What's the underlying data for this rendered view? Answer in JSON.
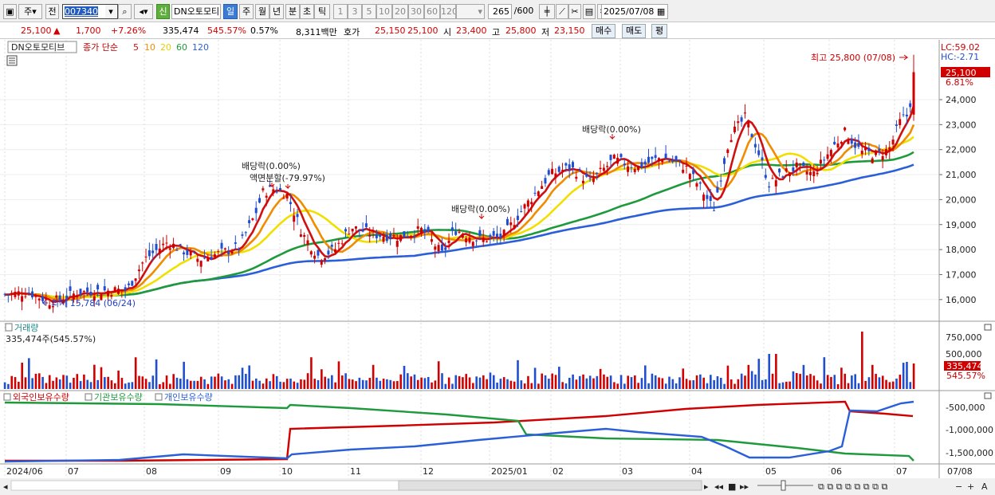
{
  "toolbar": {
    "period": "주",
    "prev": "전",
    "code": "007340",
    "news_badge": "신",
    "name": "DN오토모티",
    "tab_day": "일",
    "tab_week": "주",
    "tab_month": "월",
    "tab_year": "년",
    "tab_min": "분",
    "tab_sec": "초",
    "tab_tick": "틱",
    "nums": [
      "1",
      "3",
      "5",
      "10",
      "20",
      "30",
      "60",
      "120"
    ],
    "count": "265",
    "count_total": "/600",
    "date": "2025/07/08"
  },
  "info": {
    "price": "25,100",
    "arrow": "▲",
    "change": "1,700",
    "pct": "+7.26%",
    "volume": "335,474",
    "vol_pct": "545.57%",
    "turnover": "0.57%",
    "amount": "8,311백만",
    "quote_label": "호가",
    "ask": "25,150",
    "bid": "25,100",
    "open_label": "시",
    "open": "23,400",
    "high_label": "고",
    "high": "25,800",
    "low_label": "저",
    "low": "23,150",
    "buy": "매수",
    "sell": "매도",
    "flat": "평"
  },
  "price_panel": {
    "title": "DN오토모티브",
    "ma_label": "종가 단순",
    "ma": [
      "5",
      "10",
      "20",
      "60",
      "120"
    ],
    "lc": "LC:59.02",
    "hc": "HC:-2.71",
    "last_price": "25,100",
    "last_pct": "6.81%",
    "max_label": "최고 25,800 (07/08)",
    "min_label": "최저 15,784 (06/24)",
    "ann1": "배당락(0.00%)",
    "ann2": "액면분할(-79.97%)",
    "ann3": "배당락(0.00%)",
    "ann4": "배당락(0.00%)",
    "yticks": [
      "24,000",
      "23,000",
      "22,000",
      "21,000",
      "20,000",
      "19,000",
      "18,000",
      "17,000",
      "16,000"
    ]
  },
  "volume_panel": {
    "title": "거래량",
    "value": "335,474주(545.57%)",
    "yticks": [
      "750,000",
      "500,000"
    ],
    "last": "335,474",
    "last_pct": "545.57%"
  },
  "holding_panel": {
    "legend": [
      "외국인보유수량",
      "기관보유수량",
      "개인보유수량"
    ],
    "yticks": [
      "-500,000",
      "-1,000,000",
      "-1,500,000"
    ]
  },
  "xaxis": {
    "labels": [
      "2024/06",
      "07",
      "08",
      "09",
      "10",
      "11",
      "12",
      "2025/01",
      "02",
      "03",
      "04",
      "05",
      "06",
      "07"
    ],
    "right": "07/08"
  },
  "colors": {
    "up": "#d00000",
    "down": "#1f4fd0",
    "ma5": "#d01010",
    "ma10": "#f08c00",
    "ma20": "#f0e000",
    "ma60": "#1e9a3c",
    "ma120": "#2a5fd8"
  },
  "chart_data": {
    "type": "candlestick",
    "dates": [
      "2024/06/24",
      "2024/07",
      "2024/08",
      "2024/09",
      "2024/10",
      "2024/11",
      "2024/12",
      "2025/01",
      "2025/02",
      "2025/03",
      "2025/04",
      "2025/05",
      "2025/06",
      "2025/07/08"
    ],
    "close_approx": [
      15784,
      16500,
      17700,
      18500,
      19400,
      18300,
      18200,
      18800,
      21300,
      21600,
      20100,
      21200,
      22300,
      25100
    ],
    "last": {
      "price": 25100,
      "open": 23400,
      "high": 25800,
      "low": 23150,
      "volume": 335474
    },
    "ylim": [
      15500,
      25900
    ]
  }
}
